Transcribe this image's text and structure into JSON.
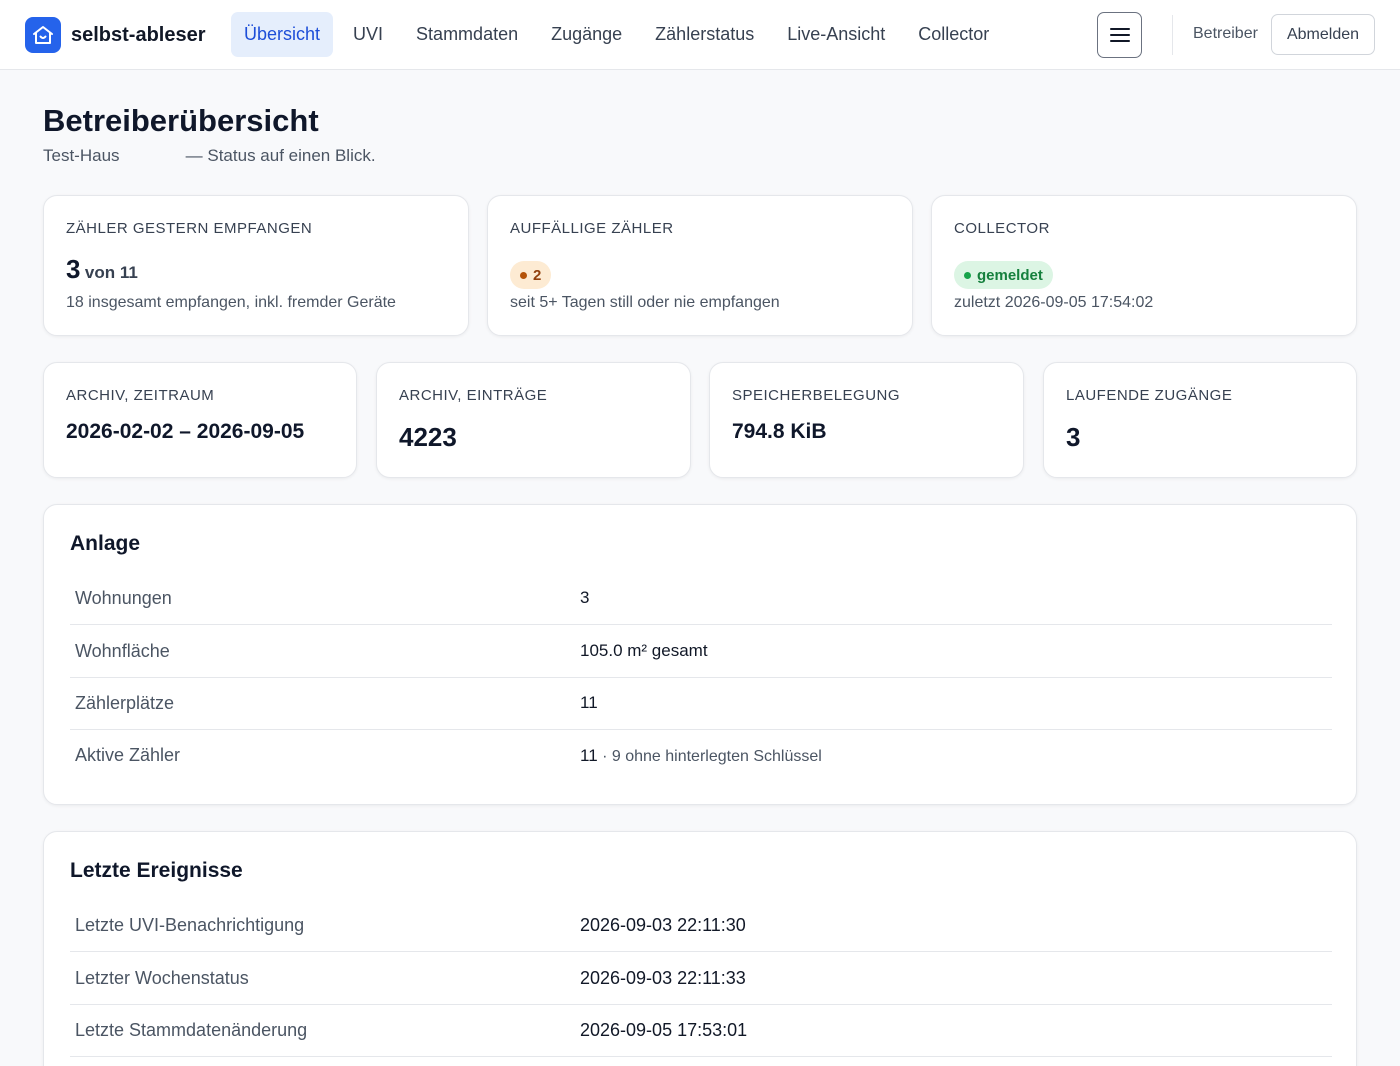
{
  "brand": {
    "name": "selbst-ableser",
    "logo_icon": "home-icon",
    "accent": "#2563eb"
  },
  "nav": {
    "items": [
      {
        "label": "Übersicht",
        "active": true
      },
      {
        "label": "UVI"
      },
      {
        "label": "Stammdaten"
      },
      {
        "label": "Zugänge"
      },
      {
        "label": "Zählerstatus"
      },
      {
        "label": "Live-Ansicht"
      },
      {
        "label": "Collector"
      }
    ],
    "menu_icon": "hamburger-menu-icon",
    "role": "Betreiber",
    "logout_label": "Abmelden"
  },
  "page": {
    "title": "Betreiberübersicht",
    "subtitle": "Test-Haus              — Status auf einen Blick."
  },
  "stats_top": {
    "received": {
      "label": "Zähler gestern empfangen",
      "value": "3",
      "of": "von 11",
      "note": "18 insgesamt empfangen, inkl. fremder Geräte"
    },
    "anomalous": {
      "label": "Auffällige Zähler",
      "badge": "2",
      "badge_color": "#92400e",
      "note": "seit 5+ Tagen still oder nie empfangen"
    },
    "collector": {
      "label": "Collector",
      "badge": "gemeldet",
      "badge_color": "#15803d",
      "note": "zuletzt 2026-09-05 17:54:02"
    }
  },
  "stats_bottom": {
    "archive_range": {
      "label": "Archiv, Zeitraum",
      "value": "2026-02-02 – 2026-09-05"
    },
    "archive_entries": {
      "label": "Archiv, Einträge",
      "value": "4223"
    },
    "storage": {
      "label": "Speicherbelegung",
      "value": "794.8 KiB"
    },
    "running_access": {
      "label": "Laufende Zugänge",
      "value": "3"
    }
  },
  "anlage": {
    "title": "Anlage",
    "rows": [
      {
        "key": "Wohnungen",
        "value": "3"
      },
      {
        "key": "Wohnfläche",
        "value": "105.0 m² gesamt"
      },
      {
        "key": "Zählerplätze",
        "value": "11"
      },
      {
        "key": "Aktive Zähler",
        "value": "11",
        "extra": " · 9 ohne hinterlegten Schlüssel"
      }
    ]
  },
  "events": {
    "title": "Letzte Ereignisse",
    "rows": [
      {
        "key": "Letzte UVI-Benachrichtigung",
        "value": "2026-09-03 22:11:30"
      },
      {
        "key": "Letzter Wochenstatus",
        "value": "2026-09-03 22:11:33"
      },
      {
        "key": "Letzte Stammdatenänderung",
        "value": "2026-09-05 17:53:01"
      }
    ]
  }
}
